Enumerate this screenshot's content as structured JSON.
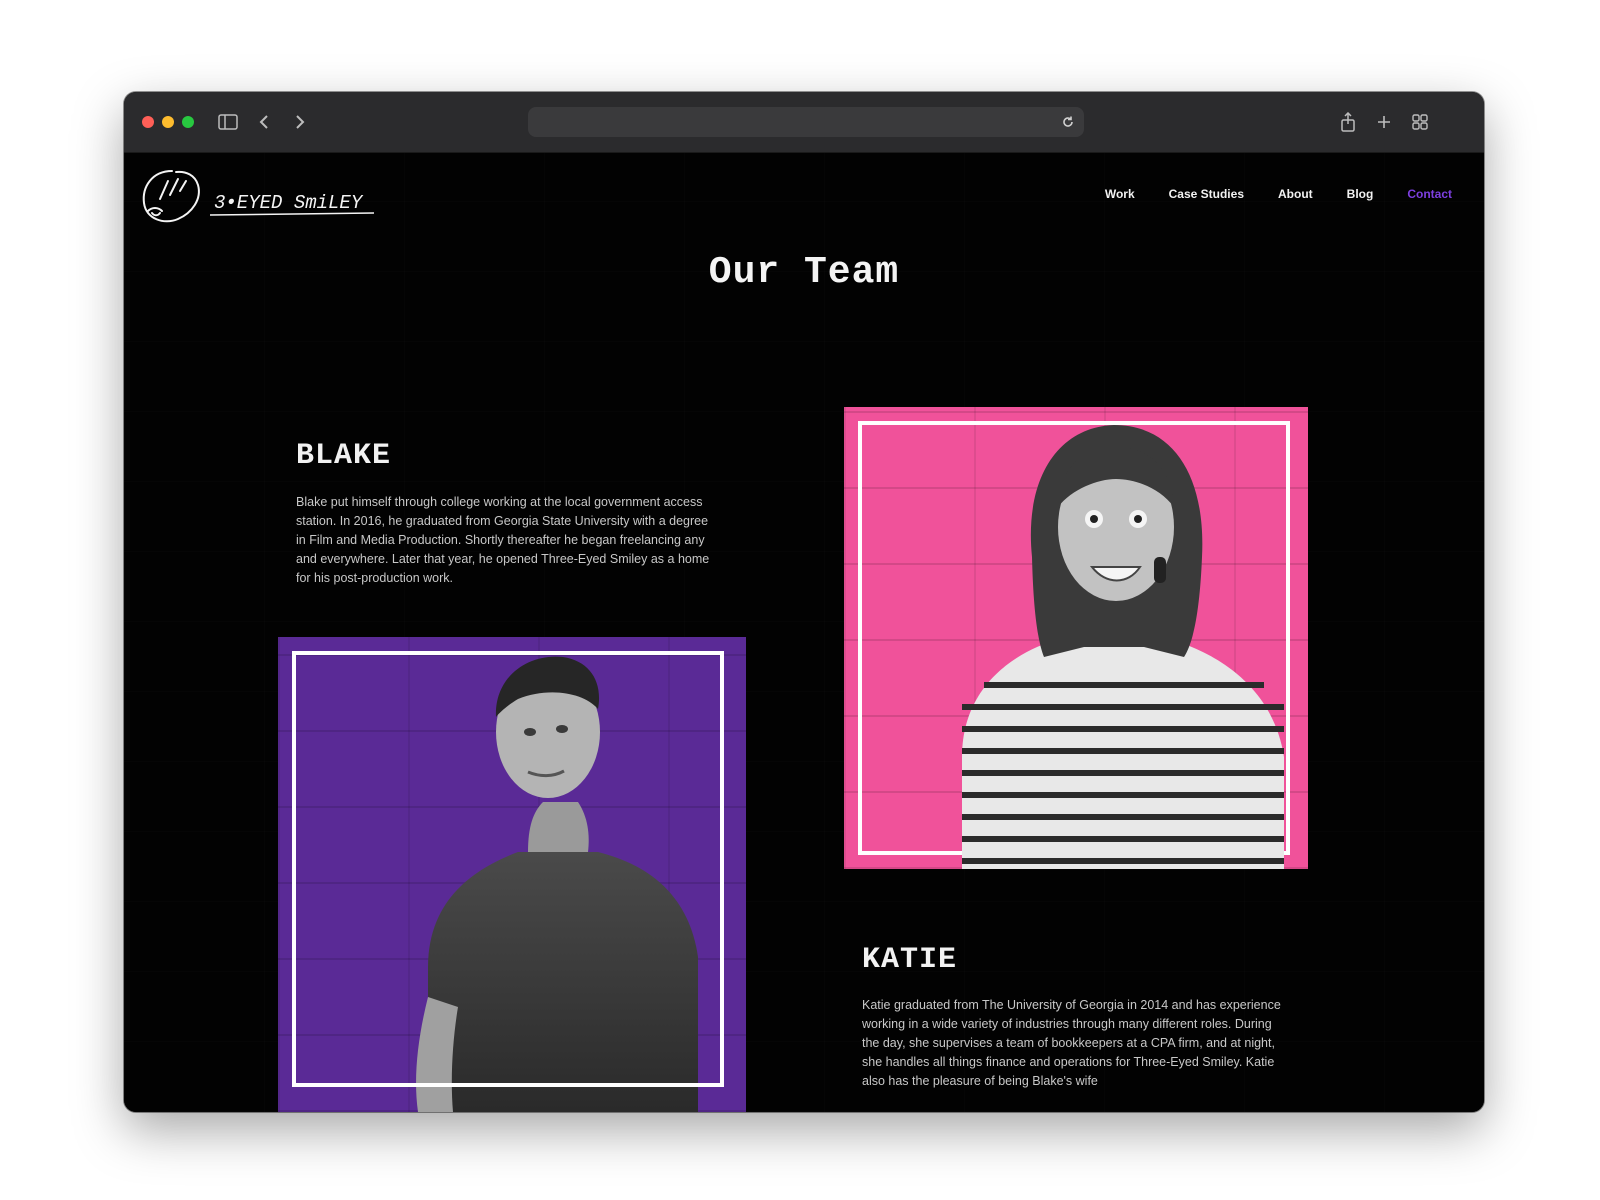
{
  "browser": {
    "url_text": "",
    "traffic_colors": [
      "#ff5f57",
      "#febc2e",
      "#28c840"
    ],
    "icons": [
      "sidebar-icon",
      "back-icon",
      "forward-icon",
      "reload-icon",
      "share-icon",
      "new-tab-icon",
      "tab-overview-icon"
    ]
  },
  "site": {
    "logo_text": "3•EYED SmiLEY",
    "nav": [
      {
        "label": "Work"
      },
      {
        "label": "Case Studies"
      },
      {
        "label": "About"
      },
      {
        "label": "Blog"
      },
      {
        "label": "Contact",
        "active": true
      }
    ],
    "page_title": "Our Team",
    "accent_color": "#7d3fe0"
  },
  "team": [
    {
      "name": "BLAKE",
      "bio": "Blake put himself through college working at the local government access station.  In 2016, he graduated from Georgia State University with a degree in Film and Media Production. Shortly thereafter he began freelancing any and everywhere.  Later that year, he opened Three-Eyed Smiley as a home for his post-production work.",
      "photo_bg": "#5a2a96"
    },
    {
      "name": "KATIE",
      "bio": "Katie graduated from The University of Georgia in 2014 and has experience working in a wide variety of industries through many different roles.  During the day, she supervises a team of bookkeepers at a CPA firm, and at night, she handles all things finance and operations for Three-Eyed Smiley.  Katie also has the pleasure of being Blake's wife",
      "photo_bg": "#f0529a"
    }
  ]
}
